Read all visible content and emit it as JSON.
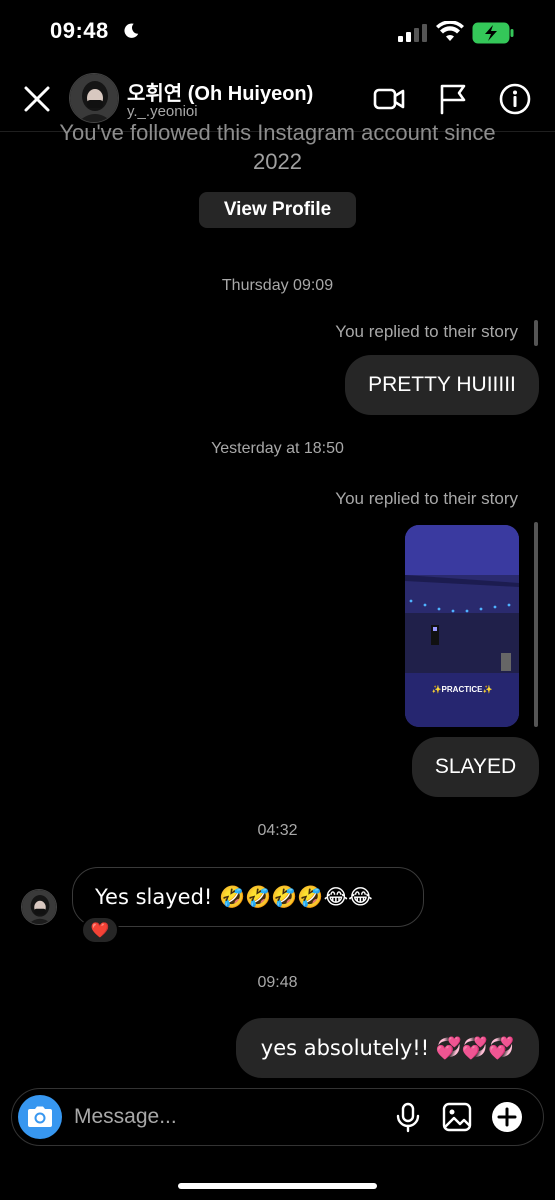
{
  "status_bar": {
    "time": "09:48"
  },
  "header": {
    "name": "오휘연 (Oh Huiyeon)",
    "username": "y._.yeonioi"
  },
  "profile_card": {
    "followed_text": "You've followed this Instagram account since",
    "followed_year": "2022",
    "view_profile_label": "View Profile"
  },
  "messages": {
    "ts1": "Thursday 09:09",
    "reply_note1": "You replied to their story",
    "msg1": "PRETTY HUIIIII",
    "ts2": "Yesterday at 18:50",
    "reply_note2": "You replied to their story",
    "story_label": "✨PRACTICE✨",
    "msg2": "SLAYED",
    "ts3": "04:32",
    "msg3": "Yes slayed! 🤣🤣🤣🤣😂😂",
    "reaction": "❤️",
    "ts4": "09:48",
    "msg4": "yes absolutely!! 💞💞💞"
  },
  "composer": {
    "placeholder": "Message..."
  },
  "colors": {
    "accent": "#3797f0",
    "bubble": "#262626",
    "battery": "#34c759"
  },
  "icons": [
    "moon-icon",
    "signal-icon",
    "wifi-icon",
    "battery-icon",
    "close-icon",
    "video-call-icon",
    "flag-icon",
    "info-icon",
    "camera-icon",
    "microphone-icon",
    "gallery-icon",
    "plus-icon"
  ]
}
